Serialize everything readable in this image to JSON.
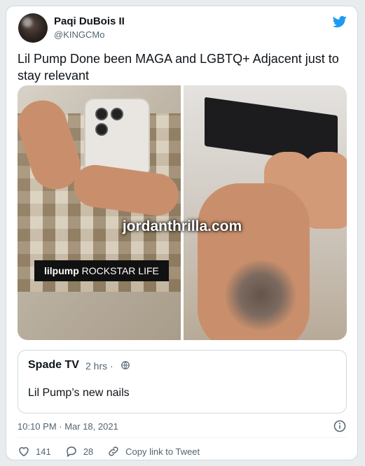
{
  "tweet": {
    "author_name": "Paqi DuBois II",
    "author_handle": "@KINGCMo",
    "text": "Lil Pump Done been MAGA and LGBTQ+ Adjacent just to stay relevant",
    "timestamp": "10:10 PM · Mar 18, 2021",
    "brand_color": "#1d9bf0"
  },
  "media": {
    "overlay_user": "lilpump",
    "overlay_text": "ROCKSTAR LIFE",
    "watermark": "jordanthrilla.com"
  },
  "quote": {
    "author": "Spade TV",
    "time": "2 hrs ·",
    "text": "Lil Pump’s new nails"
  },
  "actions": {
    "likes": "141",
    "replies": "28",
    "copy_link": "Copy link to Tweet"
  },
  "icons": [
    "twitter-bird-icon",
    "globe-icon",
    "info-icon",
    "heart-icon",
    "reply-icon",
    "link-icon"
  ]
}
